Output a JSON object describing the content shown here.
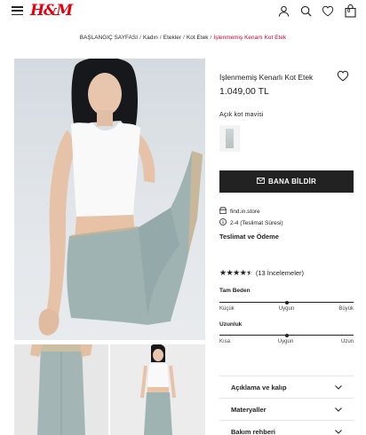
{
  "header": {
    "logo": "H&M",
    "bag_count": "0",
    "icons": [
      "menu-icon",
      "user-icon",
      "search-icon",
      "heart-icon",
      "bag-icon"
    ]
  },
  "breadcrumb": {
    "items": [
      "BAŞLANGIÇ SAYFASI",
      "Kadın",
      "Etekler",
      "Kot Etek"
    ],
    "current": "İşlenmemiş Kenarlı Kot Etek"
  },
  "product": {
    "title": "İşlenmemiş Kenarlı Kot Etek",
    "price": "1.049,00 TL",
    "color_name": "Açık kot mavisi",
    "notify_label": "BANA BİLDİR",
    "store_label": "find.in.store",
    "delivery_label": "2-4 (Teslimat Süresi)",
    "shipping_link": "Teslimat ve Ödeme",
    "rating_stars": 4.5,
    "rating_text": "(13 İncelemeler)"
  },
  "fit": {
    "size": {
      "label": "Tam Beden",
      "low": "Küçük",
      "mid": "Uygun",
      "high": "Büyük",
      "value": 0.5
    },
    "length": {
      "label": "Uzunluk",
      "low": "Kısa",
      "mid": "Uygun",
      "high": "Uzun",
      "value": 0.5
    }
  },
  "accordions": [
    {
      "label": "Açıklama ve kalıp"
    },
    {
      "label": "Materyaller"
    },
    {
      "label": "Bakım rehberi"
    }
  ],
  "colors": {
    "brand": "#e50010",
    "breadcrumb_current": "#c4012f",
    "button_bg": "#222222",
    "denim": "#9fb3b3"
  }
}
